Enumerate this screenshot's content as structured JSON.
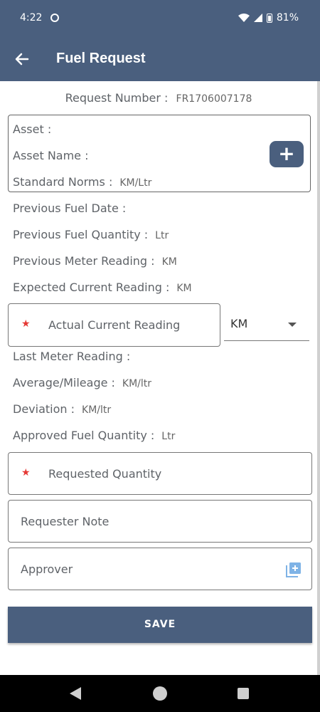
{
  "status": {
    "time": "4:22",
    "battery": "81%"
  },
  "appbar": {
    "title": "Fuel Request"
  },
  "request": {
    "label": "Request Number :",
    "value": "FR1706007178"
  },
  "asset": {
    "asset_label": "Asset :",
    "asset_name_label": "Asset Name :",
    "standard_norms_label": "Standard Norms :",
    "standard_norms_unit": "KM/Ltr",
    "add_label": "+"
  },
  "info": {
    "previous_fuel_date": "Previous Fuel Date :",
    "previous_fuel_quantity": "Previous Fuel Quantity :",
    "previous_fuel_quantity_unit": "Ltr",
    "previous_meter_reading": "Previous Meter Reading :",
    "previous_meter_reading_unit": "KM",
    "expected_current_reading": "Expected Current Reading :",
    "expected_current_reading_unit": "KM"
  },
  "actual_reading": {
    "label": "Actual Current Reading",
    "required": "★"
  },
  "unit_select": {
    "value": "KM"
  },
  "info2": {
    "last_meter_reading": "Last Meter Reading :",
    "average_mileage": "Average/Mileage :",
    "average_mileage_unit": "KM/ltr",
    "deviation": "Deviation :",
    "deviation_unit": "KM/ltr",
    "approved_fuel_quantity": "Approved Fuel Quantity :",
    "approved_fuel_quantity_unit": "Ltr"
  },
  "requested_quantity": {
    "label": "Requested Quantity",
    "required": "★"
  },
  "requester_note": {
    "label": "Requester Note"
  },
  "approver": {
    "label": "Approver"
  },
  "save": {
    "label": "SAVE"
  },
  "colors": {
    "primary": "#4a5f7e",
    "required_star": "#e53935",
    "approver_icon": "#7fb3e6"
  }
}
